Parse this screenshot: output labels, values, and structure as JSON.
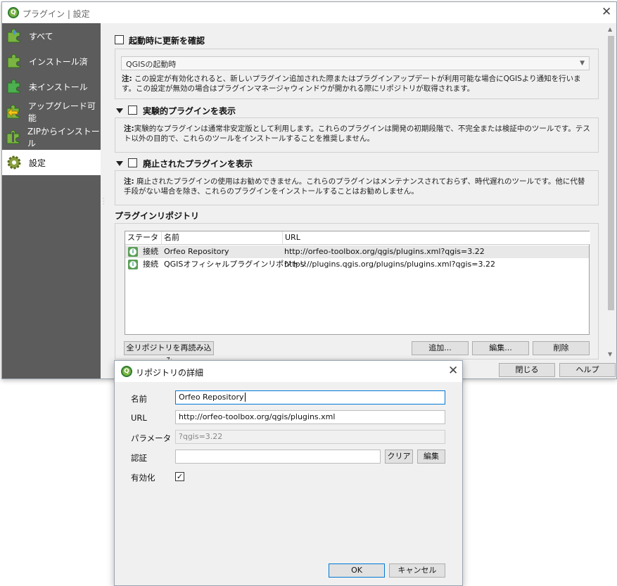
{
  "main_window": {
    "title": "プラグイン | 設定",
    "sidebar": {
      "items": [
        {
          "label": "すべて",
          "icon": "puzzle-all-icon"
        },
        {
          "label": "インストール済",
          "icon": "puzzle-installed-icon"
        },
        {
          "label": "未インストール",
          "icon": "puzzle-not-installed-icon"
        },
        {
          "label": "アップグレード可能",
          "icon": "puzzle-upgrade-icon"
        },
        {
          "label": "ZIPからインストール",
          "icon": "zip-install-icon"
        },
        {
          "label": "設定",
          "icon": "gear-icon"
        }
      ]
    },
    "settings": {
      "check_updates_label": "起動時に更新を確認",
      "check_updates_option": "QGISの起動時",
      "check_updates_note_prefix": "注:",
      "check_updates_note": " この設定が有効化されると、新しいプラグイン追加された際またはプラグインアップデートが利用可能な場合にQGISより通知を行います。この設定が無効の場合はプラグインマネージャウィンドウが開かれる際にリポジトリが取得されます。",
      "experimental_label": "実験的プラグインを表示",
      "experimental_note_prefix": "注:",
      "experimental_note": "実験的なプラグインは通常非安定版として利用します。これらのプラグインは開発の初期段階で、不完全または検証中のツールです。テスト以外の目的で、これらのツールをインストールすることを推奨しません。",
      "deprecated_label": "廃止されたプラグインを表示",
      "deprecated_note_prefix": "注:",
      "deprecated_note": " 廃止されたプラグインの使用はお勧めできません。これらのプラグインはメンテナンスされておらず、時代遅れのツールです。他に代替手段がない場合を除き、これらのプラグインをインストールすることはお勧めしません。",
      "repositories_heading": "プラグインリポジトリ"
    },
    "repo_table": {
      "columns": [
        "ステータス",
        "名前",
        "URL"
      ],
      "rows": [
        {
          "status": "接続",
          "name": "Orfeo Repository",
          "url": "http://orfeo-toolbox.org/qgis/plugins.xml?qgis=3.22"
        },
        {
          "status": "接続",
          "name": "QGISオフィシャルプラグインリポジトリ",
          "url": "https://plugins.qgis.org/plugins/plugins.xml?qgis=3.22"
        }
      ]
    },
    "buttons": {
      "reload_all": "全リポジトリを再読み込み",
      "add": "追加...",
      "edit": "編集...",
      "delete": "削除",
      "close": "閉じる",
      "help": "ヘルプ"
    }
  },
  "dialog": {
    "title": "リポジトリの詳細",
    "fields": {
      "name_label": "名前",
      "name_value": "Orfeo Repository",
      "url_label": "URL",
      "url_value": "http://orfeo-toolbox.org/qgis/plugins.xml",
      "params_label": "パラメータ",
      "params_value": "?qgis=3.22",
      "auth_label": "認証",
      "auth_value": "",
      "enabled_label": "有効化"
    },
    "buttons": {
      "clear": "クリア",
      "edit": "編集",
      "ok": "OK",
      "cancel": "キャンセル"
    }
  },
  "colors": {
    "sidebar_bg": "#5c5c5c",
    "accent": "#0078d7",
    "qgis_green": "#7cb342"
  }
}
